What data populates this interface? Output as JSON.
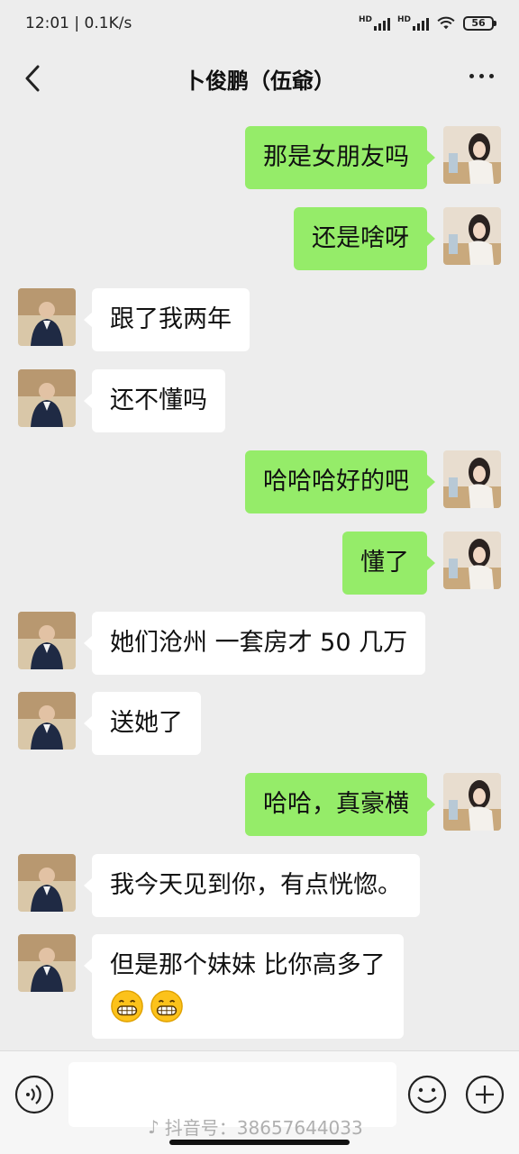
{
  "status": {
    "time": "12:01",
    "speed": "0.1K/s",
    "network_label": "HD",
    "battery": "56"
  },
  "header": {
    "title": "卜俊鹏（伍爺）"
  },
  "messages": [
    {
      "side": "me",
      "text": "那是女朋友吗"
    },
    {
      "side": "me",
      "text": "还是啥呀"
    },
    {
      "side": "them",
      "text": "跟了我两年"
    },
    {
      "side": "them",
      "text": "还不懂吗"
    },
    {
      "side": "me",
      "text": "哈哈哈好的吧"
    },
    {
      "side": "me",
      "text": "懂了"
    },
    {
      "side": "them",
      "text": "她们沧州 一套房才 50 几万"
    },
    {
      "side": "them",
      "text": "送她了"
    },
    {
      "side": "me",
      "text": "哈哈，真豪横"
    },
    {
      "side": "them",
      "text": "我今天见到你，有点恍惚。"
    },
    {
      "side": "them",
      "text": "但是那个妹妹 比你高多了",
      "emoji": [
        "grinning-face",
        "grinning-face"
      ]
    }
  ],
  "icons": {
    "back": "chevron-left-icon",
    "more": "more-icon",
    "voice": "voice-icon",
    "emoji": "emoji-icon",
    "plus": "plus-icon"
  },
  "colors": {
    "background": "#ededed",
    "my_bubble": "#95ec69",
    "their_bubble": "#ffffff"
  },
  "watermark": {
    "text": "抖音号：38657644033"
  }
}
